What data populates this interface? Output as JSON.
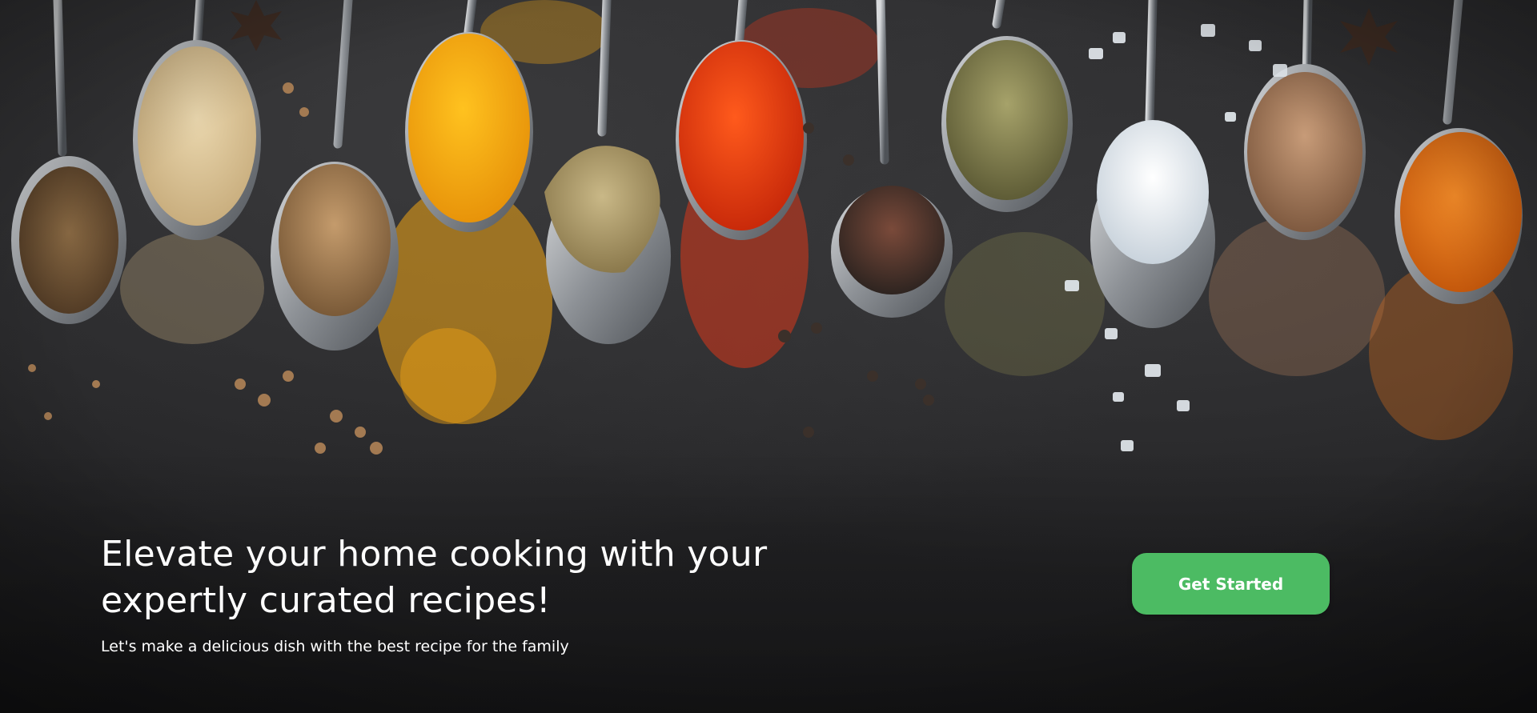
{
  "hero": {
    "headline": "Elevate your home cooking with your expertly curated recipes!",
    "subline": "Let's make a delicious dish with the best recipe for the family",
    "cta_label": "Get Started",
    "background_alt": "spices-on-spoons-photo"
  },
  "colors": {
    "cta_background": "#4cbb63",
    "text": "#ffffff",
    "background": "#252527"
  }
}
